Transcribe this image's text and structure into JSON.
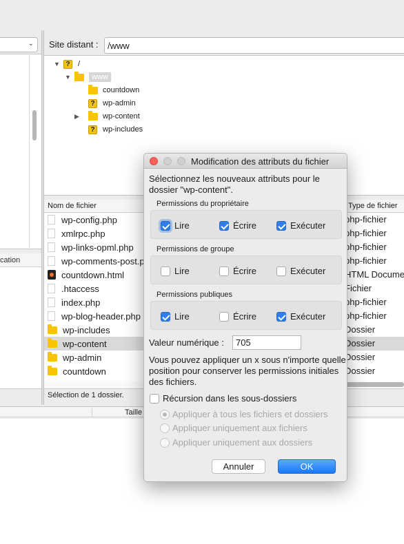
{
  "remote": {
    "label": "Site distant :",
    "path": "/www",
    "tree": [
      {
        "label": "/",
        "type": "unknown",
        "expanded": true
      },
      {
        "label": "www",
        "type": "folder",
        "expanded": true,
        "selected": true
      },
      {
        "label": "countdown",
        "type": "folder"
      },
      {
        "label": "wp-admin",
        "type": "unknown"
      },
      {
        "label": "wp-content",
        "type": "folder",
        "collapsed": true
      },
      {
        "label": "wp-includes",
        "type": "unknown"
      }
    ]
  },
  "local": {
    "column_partial": "ification"
  },
  "file_list": {
    "col_name": "Nom de fichier",
    "col_type": "Type de fichier",
    "rows": [
      {
        "name": "wp-config.php",
        "type": "php-fichier",
        "icon": "document-icon"
      },
      {
        "name": "xmlrpc.php",
        "type": "php-fichier",
        "icon": "document-icon"
      },
      {
        "name": "wp-links-opml.php",
        "type": "php-fichier",
        "icon": "document-icon"
      },
      {
        "name": "wp-comments-post.php",
        "type": "php-fichier",
        "icon": "document-icon"
      },
      {
        "name": "countdown.html",
        "type": "HTML Document",
        "icon": "html-file-icon"
      },
      {
        "name": ".htaccess",
        "type": "Fichier",
        "icon": "document-icon"
      },
      {
        "name": "index.php",
        "type": "php-fichier",
        "icon": "document-icon"
      },
      {
        "name": "wp-blog-header.php",
        "type": "php-fichier",
        "icon": "document-icon"
      },
      {
        "name": "wp-includes",
        "type": "Dossier",
        "icon": "folder-icon"
      },
      {
        "name": "wp-content",
        "type": "Dossier",
        "icon": "folder-icon",
        "selected": true
      },
      {
        "name": "wp-admin",
        "type": "Dossier",
        "icon": "folder-icon"
      },
      {
        "name": "countdown",
        "type": "Dossier",
        "icon": "folder-icon"
      }
    ],
    "status": "Sélection de 1 dossier."
  },
  "queue": {
    "col_size": "Taille"
  },
  "dialog": {
    "title": "Modification des attributs du fichier",
    "intro": "Sélectionnez les nouveaux attributs pour le dossier \"wp-content\".",
    "groups": [
      {
        "label": "Permissions du propriétaire",
        "read": true,
        "write": true,
        "exec": true
      },
      {
        "label": "Permissions de groupe",
        "read": false,
        "write": false,
        "exec": false
      },
      {
        "label": "Permissions publiques",
        "read": true,
        "write": false,
        "exec": true
      }
    ],
    "labels": {
      "read": "Lire",
      "write": "Écrire",
      "exec": "Exécuter"
    },
    "numeric_label": "Valeur numérique :",
    "numeric_value": "705",
    "hint": "Vous pouvez appliquer un x sous n'importe quelle position pour conserver les permissions initiales des fichiers.",
    "recursion_label": "Récursion dans les sous-dossiers",
    "recursion_checked": false,
    "radios": [
      {
        "label": "Appliquer à tous les fichiers et dossiers",
        "selected": true
      },
      {
        "label": "Appliquer uniquement aux fichiers",
        "selected": false
      },
      {
        "label": "Appliquer uniquement aux dossiers",
        "selected": false
      }
    ],
    "cancel": "Annuler",
    "ok": "OK"
  },
  "colors": {
    "accent": "#2f7ee9",
    "close": "#fc605b",
    "inactive_dot": "#cfcfcf",
    "folder": "#f9c400"
  }
}
